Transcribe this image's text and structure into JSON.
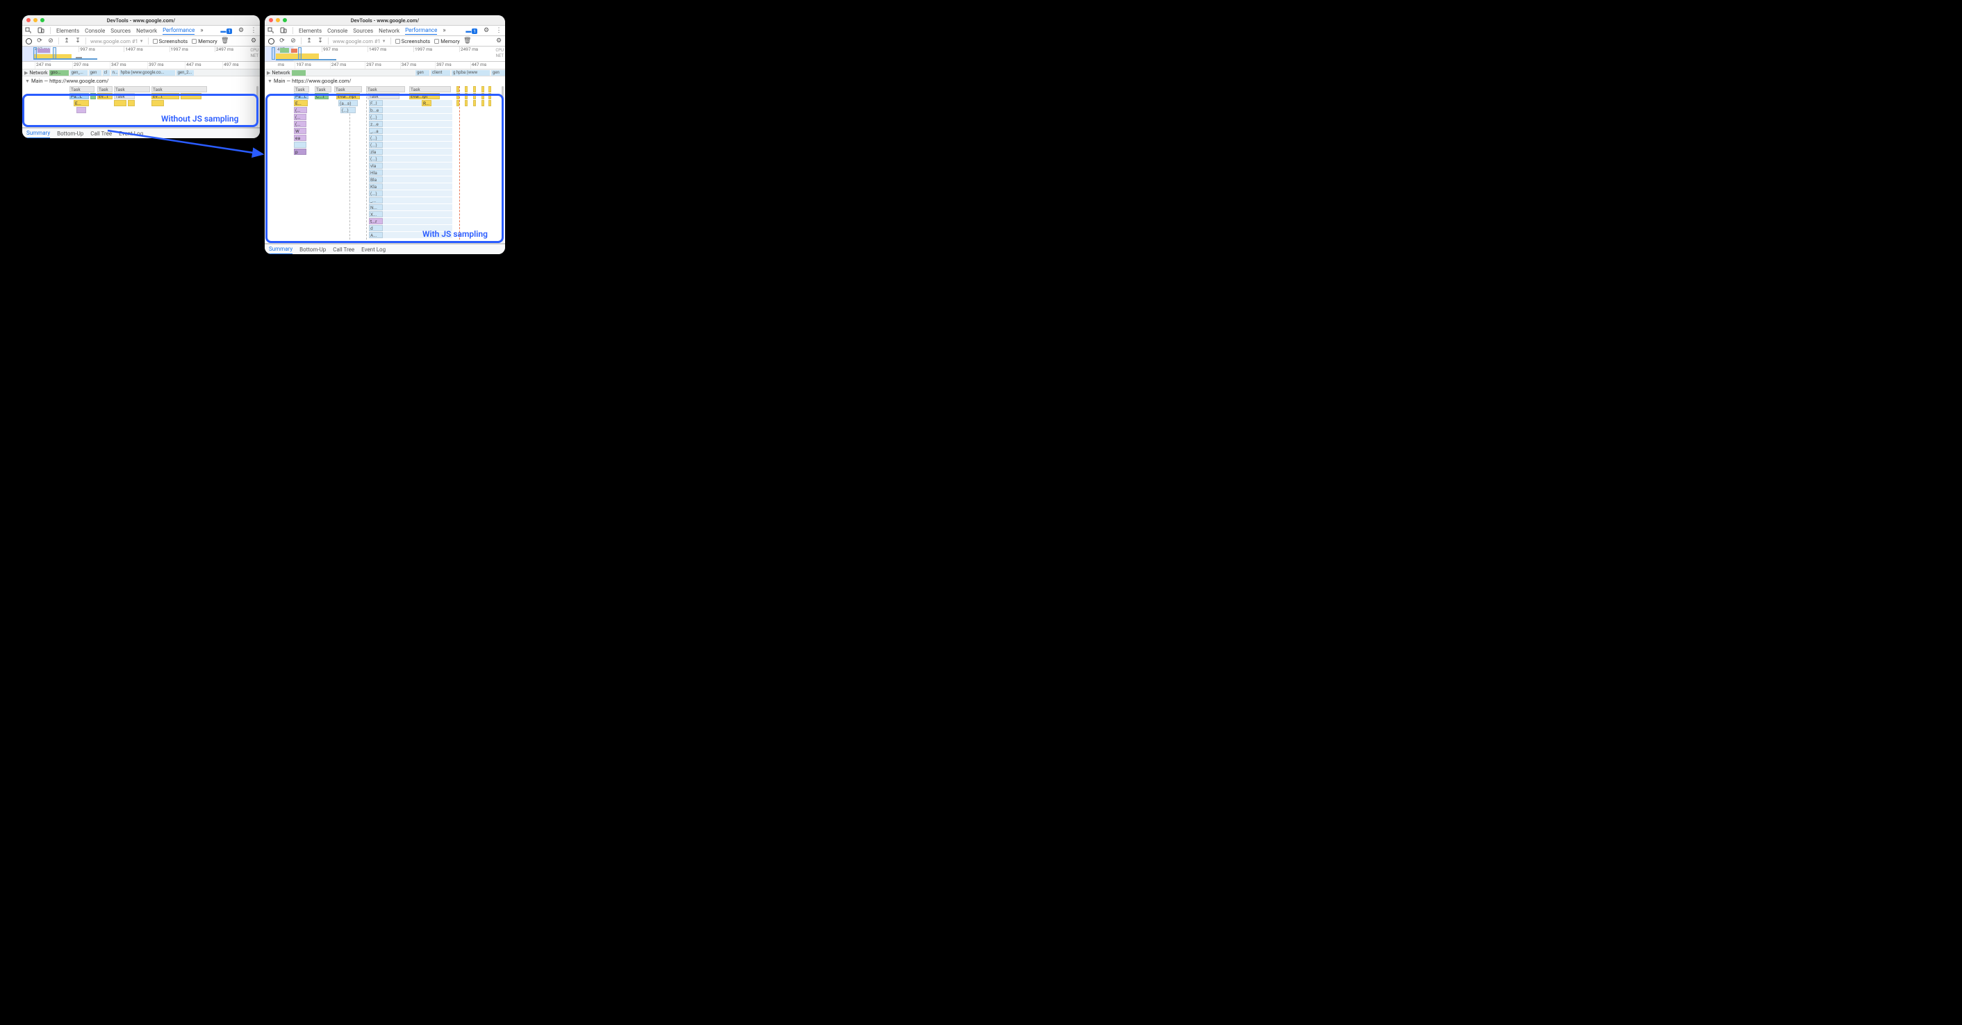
{
  "window": {
    "title": "DevTools - www.google.com/"
  },
  "tabs": {
    "elements": "Elements",
    "console": "Console",
    "sources": "Sources",
    "network": "Network",
    "performance": "Performance",
    "more": "»",
    "badge_count": "1"
  },
  "toolbar": {
    "url": "www.google.com #1",
    "screenshots": "Screenshots",
    "memory": "Memory"
  },
  "overview_left": {
    "ticks": [
      "497 ms",
      "997 ms",
      "1497 ms",
      "1997 ms",
      "2497 ms"
    ],
    "cpu": "CPU",
    "net": "NET"
  },
  "overview_right": {
    "ticks": [
      "497",
      "997 ms",
      "1497 ms",
      "1997 ms",
      "2497 ms"
    ],
    "cpu": "CPU",
    "net": "NET"
  },
  "ruler_left": [
    "247 ms",
    "297 ms",
    "347 ms",
    "397 ms",
    "447 ms",
    "497 ms"
  ],
  "ruler_right": [
    "197 ms",
    "247 ms",
    "297 ms",
    "347 ms",
    "397 ms",
    "447 ms"
  ],
  "network_row": {
    "label": "Network",
    "items_left": [
      "goo...",
      "gen_...",
      "gen",
      "cl",
      "n...",
      "hpba (www.google.co...",
      "gen_2..."
    ],
    "items_right": [
      "gen",
      "client",
      "g hpba (www",
      "gen"
    ]
  },
  "main_thread": {
    "label": "Main — https://www.google.com/"
  },
  "bottom": {
    "summary": "Summary",
    "bottomup": "Bottom-Up",
    "calltree": "Call Tree",
    "eventlog": "Event Log"
  },
  "annotations": {
    "without": "Without JS sampling",
    "with": "With JS sampling"
  },
  "flame_left": {
    "row0": [
      "Task",
      "Task",
      "Task",
      "Task"
    ],
    "row1": [
      "Pa...L",
      "Ev...t",
      "Task",
      "Ev...t"
    ],
    "row2": [
      "E..."
    ]
  },
  "flame_right": {
    "col0": [
      "Task",
      "Pa...L",
      "E...",
      "(...",
      "(...",
      "(...",
      "W",
      "ea",
      "",
      "p"
    ],
    "col1_head": "Task",
    "col1_a": "C...t",
    "col2": [
      "Task",
      "Eval...ript",
      "(a...s)",
      "(...)"
    ],
    "col3": [
      "Task",
      "Task",
      "F...l",
      "b...e",
      "(...)",
      "z...e",
      "_...a",
      "(...)",
      "(...)",
      "zla",
      "(...)",
      "vla",
      "Hla",
      "Bla",
      "Kla",
      "(...)",
      "_...",
      "N...",
      "X...",
      "t...r",
      "d",
      "A..."
    ],
    "col4": [
      "Task",
      "Eval...ipt",
      "R..."
    ]
  }
}
